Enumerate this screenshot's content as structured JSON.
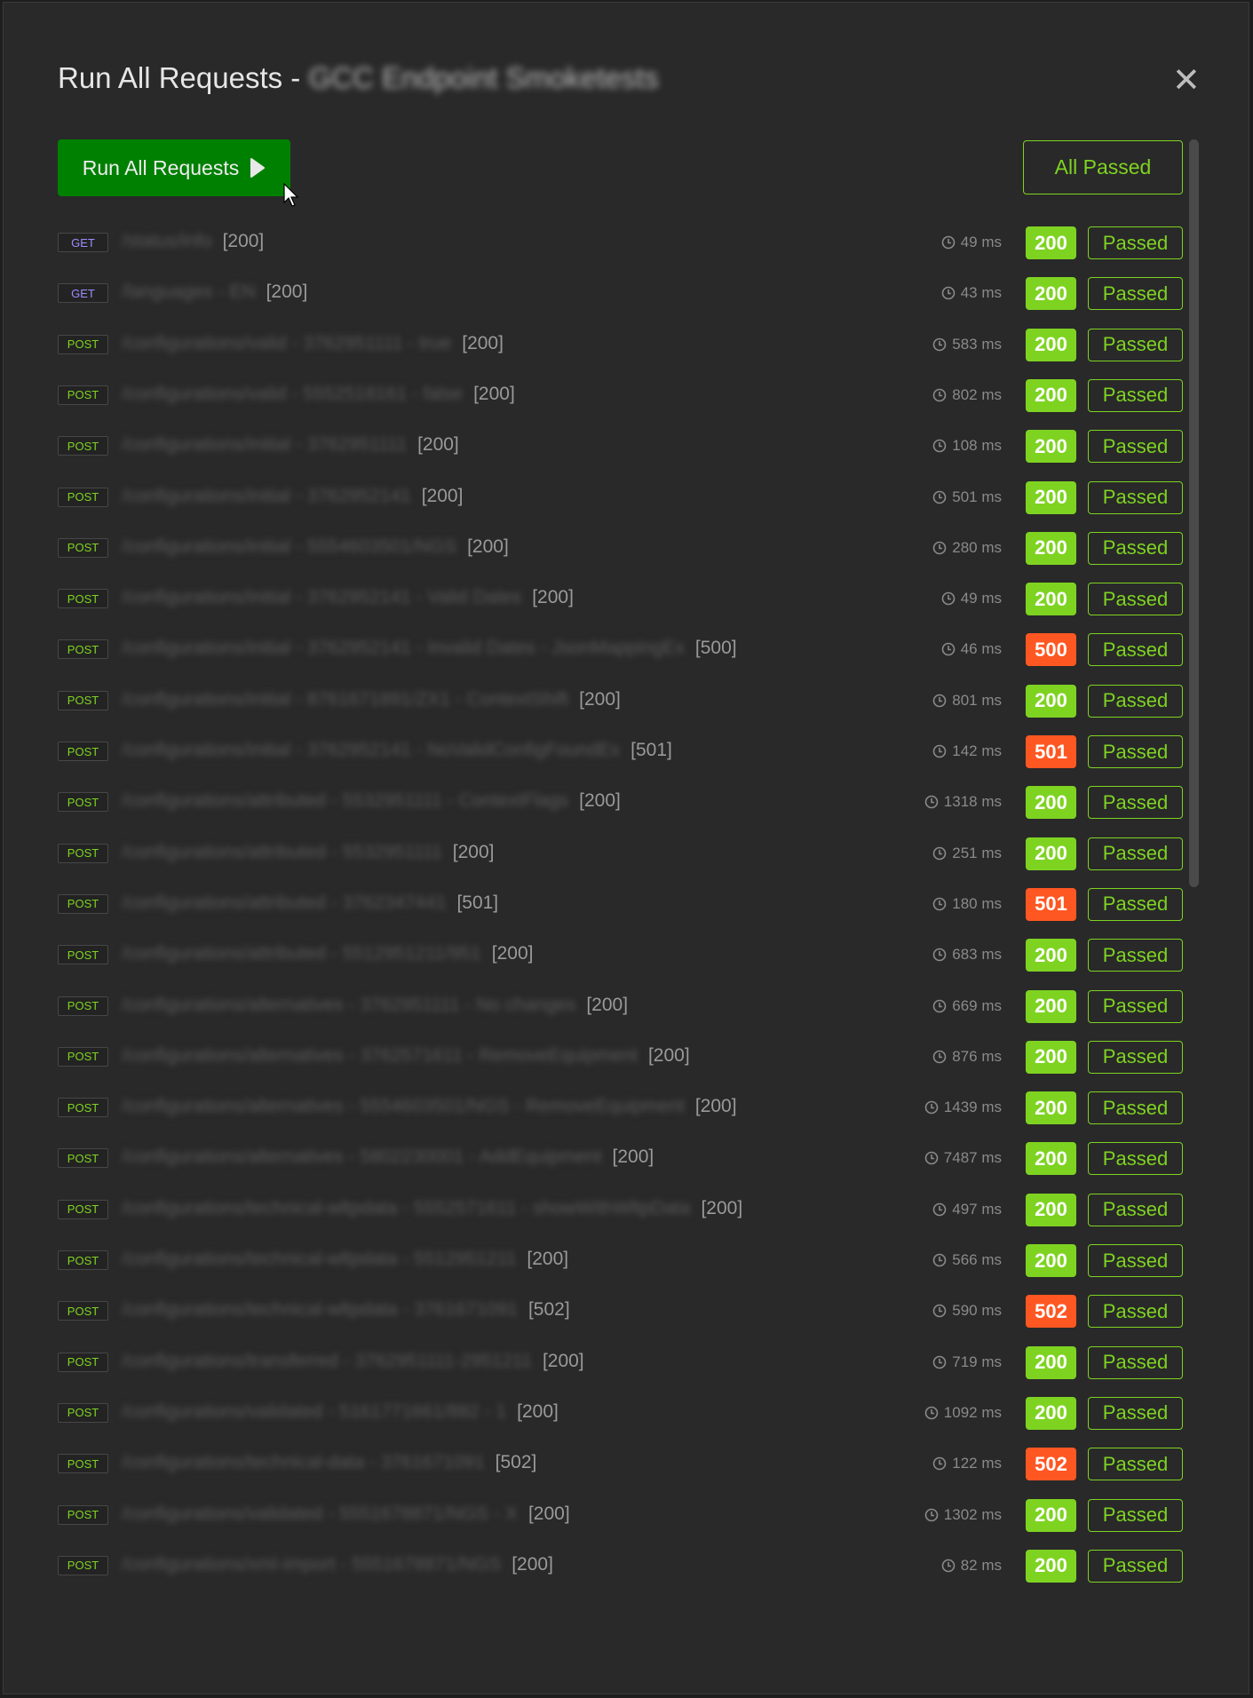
{
  "modal": {
    "title_prefix": "Run All Requests - ",
    "title_collection": "GCC Endpoint Smoketests",
    "close_icon": "close-x-icon",
    "run_button_label": "Run All Requests",
    "run_button_icon": "play-icon",
    "summary_label": "All Passed"
  },
  "colors": {
    "success": "#7ed321",
    "error": "#ff5722",
    "run_button": "#008000",
    "get": "#9b8cff"
  },
  "requests": [
    {
      "method": "GET",
      "name": "/status/info",
      "code": "[200]",
      "time": "49 ms",
      "status": "200",
      "result": "Passed"
    },
    {
      "method": "GET",
      "name": "/languages - EN",
      "code": "[200]",
      "time": "43 ms",
      "status": "200",
      "result": "Passed"
    },
    {
      "method": "POST",
      "name": "/configurations/valid - 3762951111 - true",
      "code": "[200]",
      "time": "583 ms",
      "status": "200",
      "result": "Passed"
    },
    {
      "method": "POST",
      "name": "/configurations/valid - 5552518161 - false",
      "code": "[200]",
      "time": "802 ms",
      "status": "200",
      "result": "Passed"
    },
    {
      "method": "POST",
      "name": "/configurations/initial - 3762951111",
      "code": "[200]",
      "time": "108 ms",
      "status": "200",
      "result": "Passed"
    },
    {
      "method": "POST",
      "name": "/configurations/initial - 3762952141",
      "code": "[200]",
      "time": "501 ms",
      "status": "200",
      "result": "Passed"
    },
    {
      "method": "POST",
      "name": "/configurations/initial - 5554603501/NGS",
      "code": "[200]",
      "time": "280 ms",
      "status": "200",
      "result": "Passed"
    },
    {
      "method": "POST",
      "name": "/configurations/initial - 3762952141 - Valid Dates",
      "code": "[200]",
      "time": "49 ms",
      "status": "200",
      "result": "Passed"
    },
    {
      "method": "POST",
      "name": "/configurations/initial - 3762952141 - Invalid Dates - JsonMappingEx",
      "code": "[500]",
      "time": "46 ms",
      "status": "500",
      "result": "Passed"
    },
    {
      "method": "POST",
      "name": "/configurations/initial - 8761671891/ZX1 - ContextShift",
      "code": "[200]",
      "time": "801 ms",
      "status": "200",
      "result": "Passed"
    },
    {
      "method": "POST",
      "name": "/configurations/initial - 3762952141 - NoValidConfigFoundEx",
      "code": "[501]",
      "time": "142 ms",
      "status": "501",
      "result": "Passed"
    },
    {
      "method": "POST",
      "name": "/configurations/attributed - 5532951111 - ContextFlags",
      "code": "[200]",
      "time": "1318 ms",
      "status": "200",
      "result": "Passed"
    },
    {
      "method": "POST",
      "name": "/configurations/attributed - 5532951111",
      "code": "[200]",
      "time": "251 ms",
      "status": "200",
      "result": "Passed"
    },
    {
      "method": "POST",
      "name": "/configurations/attributed - 3762347441",
      "code": "[501]",
      "time": "180 ms",
      "status": "501",
      "result": "Passed"
    },
    {
      "method": "POST",
      "name": "/configurations/attributed - 5512951211/951",
      "code": "[200]",
      "time": "683 ms",
      "status": "200",
      "result": "Passed"
    },
    {
      "method": "POST",
      "name": "/configurations/alternatives - 3762951111 - No changes",
      "code": "[200]",
      "time": "669 ms",
      "status": "200",
      "result": "Passed"
    },
    {
      "method": "POST",
      "name": "/configurations/alternatives - 3762571611 - RemoveEquipment",
      "code": "[200]",
      "time": "876 ms",
      "status": "200",
      "result": "Passed"
    },
    {
      "method": "POST",
      "name": "/configurations/alternatives - 5554603501/NGS - RemoveEquipment",
      "code": "[200]",
      "time": "1439 ms",
      "status": "200",
      "result": "Passed"
    },
    {
      "method": "POST",
      "name": "/configurations/alternatives - 5802230001 - AddEquipment",
      "code": "[200]",
      "time": "7487 ms",
      "status": "200",
      "result": "Passed"
    },
    {
      "method": "POST",
      "name": "/configurations/technical-wltpdata - 5552571611 - showWithWltpData",
      "code": "[200]",
      "time": "497 ms",
      "status": "200",
      "result": "Passed"
    },
    {
      "method": "POST",
      "name": "/configurations/technical-wltpdata - 5512951211",
      "code": "[200]",
      "time": "566 ms",
      "status": "200",
      "result": "Passed"
    },
    {
      "method": "POST",
      "name": "/configurations/technical-wltpdata - 3761671091",
      "code": "[502]",
      "time": "590 ms",
      "status": "502",
      "result": "Passed"
    },
    {
      "method": "POST",
      "name": "/configurations/transferred - 3762951111-2951211",
      "code": "[200]",
      "time": "719 ms",
      "status": "200",
      "result": "Passed"
    },
    {
      "method": "POST",
      "name": "/configurations/validated - 5161771661/882 - 1",
      "code": "[200]",
      "time": "1092 ms",
      "status": "200",
      "result": "Passed"
    },
    {
      "method": "POST",
      "name": "/configurations/technical-data - 3761671091",
      "code": "[502]",
      "time": "122 ms",
      "status": "502",
      "result": "Passed"
    },
    {
      "method": "POST",
      "name": "/configurations/validated - 5551678871/NGS - X",
      "code": "[200]",
      "time": "1302 ms",
      "status": "200",
      "result": "Passed"
    },
    {
      "method": "POST",
      "name": "/configurations/xml-import - 5551678871/NGS",
      "code": "[200]",
      "time": "82 ms",
      "status": "200",
      "result": "Passed"
    }
  ]
}
